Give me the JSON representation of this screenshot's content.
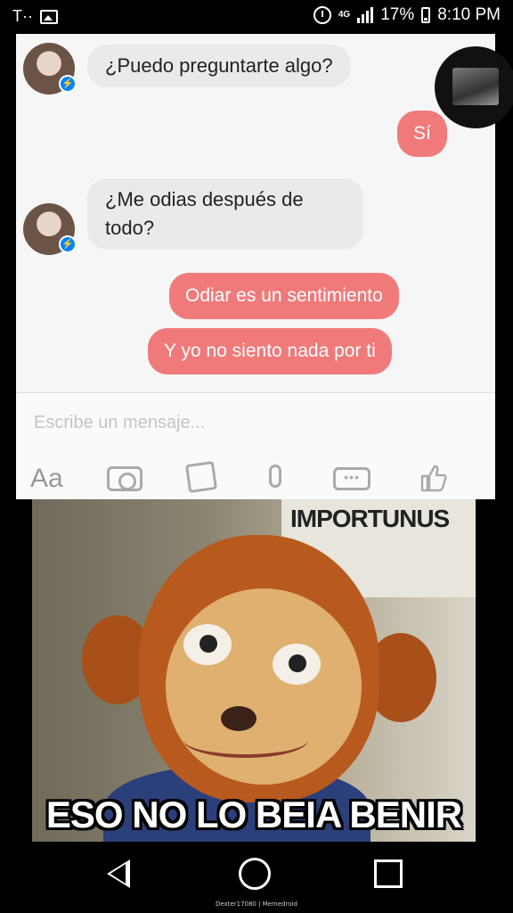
{
  "status_bar": {
    "carrier": "T··",
    "network": "4G",
    "battery": "17%",
    "time": "8:10 PM"
  },
  "chat": {
    "messages": [
      {
        "from": "them",
        "text": "¿Puedo preguntarte algo?"
      },
      {
        "from": "me",
        "text": "Sí"
      },
      {
        "from": "them",
        "text": "¿Me odias después de todo?"
      },
      {
        "from": "me",
        "text": "Odiar es un sentimiento"
      },
      {
        "from": "me",
        "text": "Y yo no siento nada por ti"
      }
    ]
  },
  "composer": {
    "placeholder": "Escribe un mensaje...",
    "aa_label": "Aa",
    "more_label": "•••"
  },
  "meme": {
    "sign_text": "IMPORTUNUS",
    "caption": "ESO NO LO BEIA BENIR"
  },
  "footer": {
    "watermark": "Dexter17080 | Memedroid"
  },
  "icons": [
    "alarm-icon",
    "signal-icon",
    "battery-icon",
    "messenger-badge-icon",
    "camera-icon",
    "image-icon",
    "microphone-icon",
    "more-icon",
    "thumbs-up-icon",
    "back-icon",
    "home-icon",
    "recents-icon"
  ],
  "colors": {
    "outgoing_bubble": "#f07a7a",
    "incoming_bubble": "#eaeaea",
    "messenger_blue": "#0084ff"
  }
}
